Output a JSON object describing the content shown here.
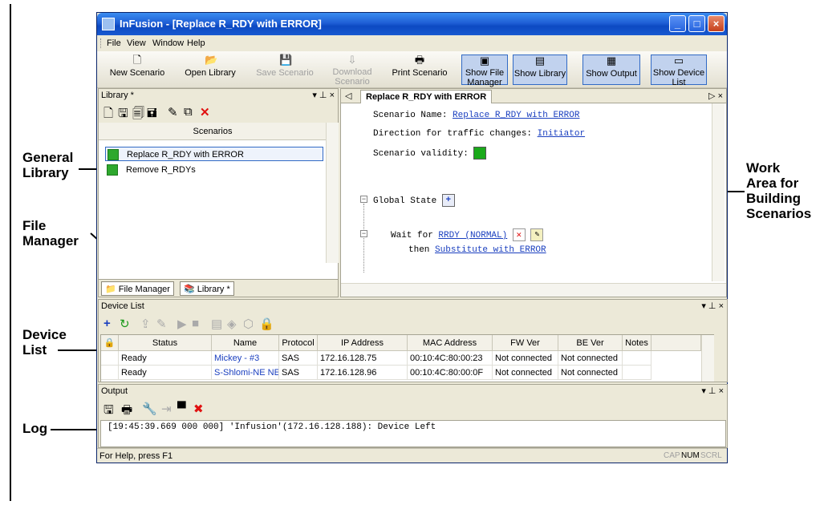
{
  "window": {
    "title": "InFusion - [Replace R_RDY with ERROR]",
    "minimize": "_",
    "maximize": "□",
    "close": "×"
  },
  "menu": [
    "File",
    "View",
    "Window",
    "Help"
  ],
  "toolbar": {
    "new_scenario": "New Scenario",
    "open_library": "Open Library",
    "save_scenario": "Save Scenario",
    "download_scenario_1": "Download",
    "download_scenario_2": "Scenario",
    "print_scenario": "Print Scenario",
    "show_file_manager_1": "Show File",
    "show_file_manager_2": "Manager",
    "show_library": "Show Library",
    "show_output": "Show Output",
    "show_device_list_1": "Show Device",
    "show_device_list_2": "List"
  },
  "library": {
    "header": "Library *",
    "pins": "▾ ⊥ ×",
    "column_header": "Scenarios",
    "scenarios": [
      {
        "label": "Replace R_RDY with ERROR",
        "selected": true
      },
      {
        "label": "Remove R_RDYs",
        "selected": false
      }
    ],
    "tabs": [
      "File Manager",
      "Library *"
    ]
  },
  "work": {
    "tab": "Replace R_RDY with ERROR",
    "tab_nav_left": "◁",
    "tab_nav_right": "▷ ×",
    "scenario_name_label": "Scenario Name: ",
    "scenario_name_value": "Replace R_RDY with ERROR",
    "direction_label": "Direction for traffic changes: ",
    "direction_value": "Initiator",
    "validity_label": "Scenario validity: ",
    "global_state": "Global State",
    "wait_label": "Wait for ",
    "wait_value": "RRDY (NORMAL)",
    "then_label": "then ",
    "then_value": "Substitute with ERROR"
  },
  "device_list": {
    "header": "Device List",
    "pins": "▾ ⊥ ×",
    "columns": [
      "Status",
      "Name",
      "Protocol",
      "IP Address",
      "MAC Address",
      "FW Ver",
      "BE Ver",
      "Notes"
    ],
    "rows": [
      [
        "Ready",
        "Mickey - #3",
        "SAS",
        "172.16.128.75",
        "00:10:4C:80:00:23",
        "Not connected",
        "Not connected",
        ""
      ],
      [
        "Ready",
        "S-Shlomi-NE NE",
        "SAS",
        "172.16.128.96",
        "00:10:4C:80:00:0F",
        "Not connected",
        "Not connected",
        ""
      ]
    ]
  },
  "output": {
    "header": "Output",
    "pins": "▾ ⊥ ×",
    "log_line": "[19:45:39.669 000 000] 'Infusion'(172.16.128.188): Device Left"
  },
  "status": {
    "help": "For Help, press F1",
    "cap": "CAP",
    "num": "NUM",
    "scrl": "SCRL"
  },
  "annotations": {
    "general_library_1": "General",
    "general_library_2": "Library",
    "file_manager_1": "File",
    "file_manager_2": "Manager",
    "device_list_1": "Device",
    "device_list_2": "List",
    "log": "Log",
    "work_area_1": "Work",
    "work_area_2": "Area for",
    "work_area_3": "Building",
    "work_area_4": "Scenarios"
  }
}
